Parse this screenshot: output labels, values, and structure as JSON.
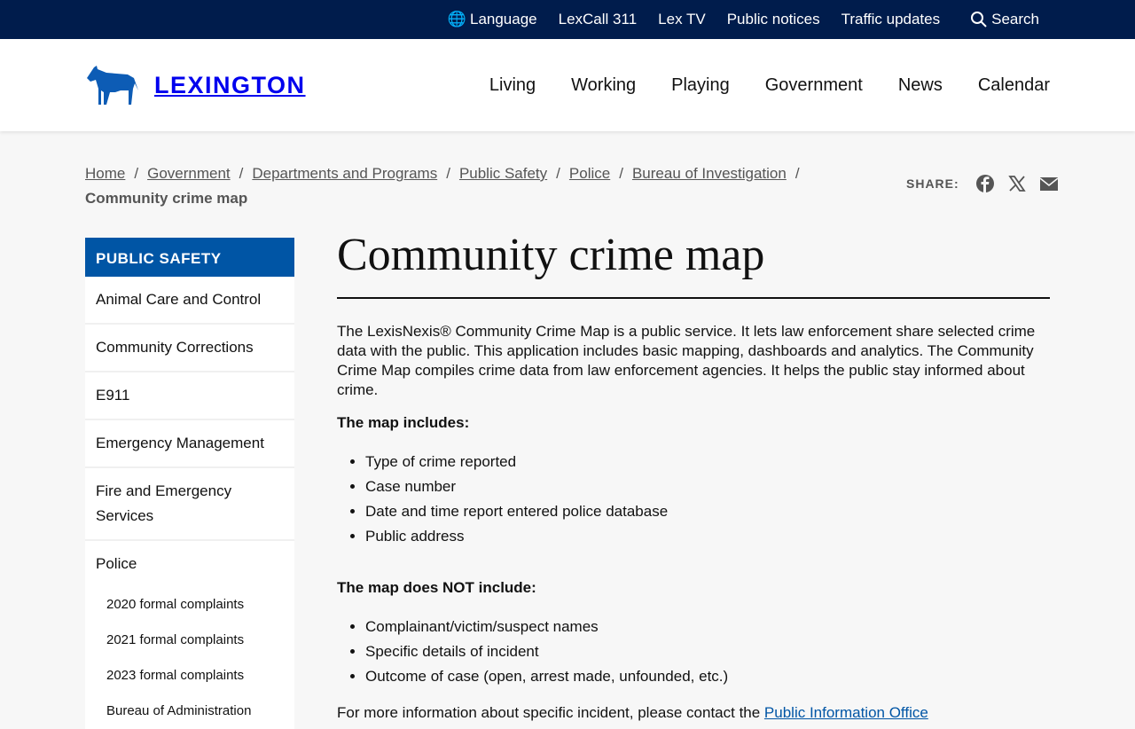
{
  "utility": {
    "language": "Language",
    "lexcall": "LexCall 311",
    "lextv": "Lex TV",
    "notices": "Public notices",
    "traffic": "Traffic updates",
    "search": "Search"
  },
  "logo": "LEXINGTON",
  "nav": [
    "Living",
    "Working",
    "Playing",
    "Government",
    "News",
    "Calendar"
  ],
  "breadcrumb": [
    "Home",
    "Government",
    "Departments and Programs",
    "Public Safety",
    "Police",
    "Bureau of Investigation"
  ],
  "current": "Community crime map",
  "share_label": "SHARE:",
  "sidebar": {
    "heading": "PUBLIC SAFETY",
    "items": [
      "Animal Care and Control",
      "Community Corrections",
      "E911",
      "Emergency Management",
      "Fire and Emergency Services",
      "Police"
    ],
    "sub": [
      "2020 formal complaints",
      "2021 formal complaints",
      "2023 formal complaints",
      "Bureau of Administration"
    ]
  },
  "main": {
    "title": "Community crime map",
    "intro": "The LexisNexis® Community Crime Map is a public service. It lets law enforcement share selected crime data with the public. This application includes basic mapping, dashboards  and analytics. The Community Crime Map compiles crime data from law enforcement agencies. It helps the public stay informed about crime.",
    "includes_heading": "The map includes:",
    "includes": [
      "Type of crime reported",
      "Case number",
      "Date and time report entered police database",
      "Public address"
    ],
    "excludes_heading": "The map does NOT include:",
    "excludes": [
      "Complainant/victim/suspect names",
      "Specific details of incident",
      "Outcome of case (open, arrest made, unfounded, etc.)"
    ],
    "more": "For more information about specific incident, please contact the ",
    "more_link": "Public Information Office"
  }
}
